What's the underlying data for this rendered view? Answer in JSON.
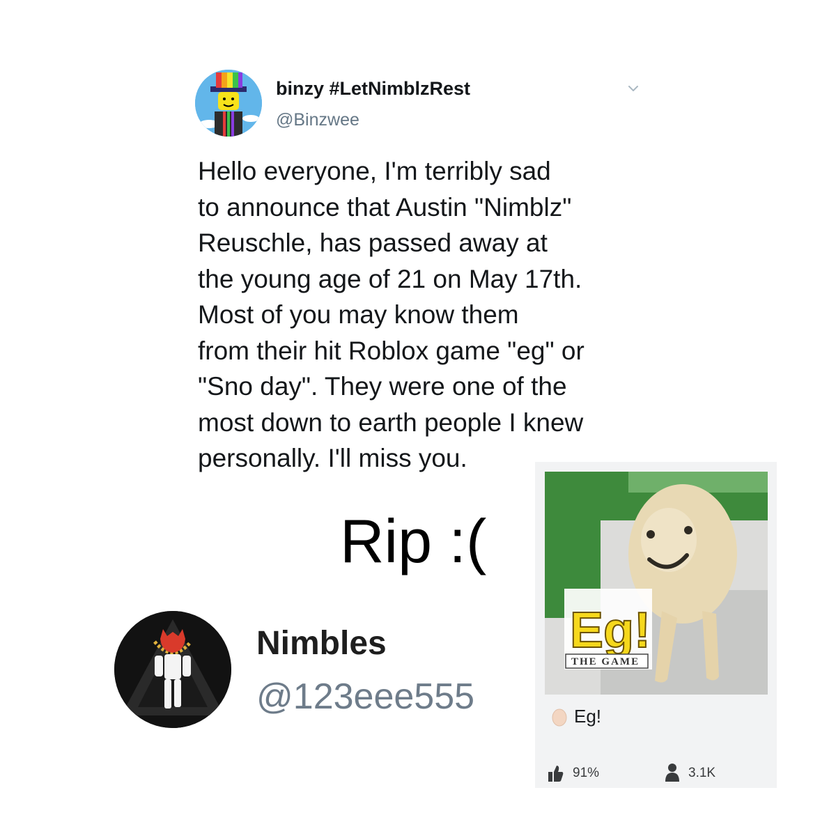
{
  "tweet": {
    "display_name": "binzy #LetNimblzRest",
    "handle": "@Binzwee",
    "body_lines": [
      "Hello everyone, I'm terribly sad",
      "to announce that Austin \"Nimblz\"",
      "Reuschle, has passed away at",
      "the young age of 21 on May 17th.",
      "Most of you may know them",
      "from their hit Roblox game \"eg\" or",
      "\"Sno day\". They were one of the",
      "most down to earth people I knew",
      "personally. I'll miss you."
    ],
    "menu_icon": "chevron-down-icon"
  },
  "caption": "Rip :(",
  "profile": {
    "name": "Nimbles",
    "handle": "@123eee555"
  },
  "game": {
    "title": "Eg!",
    "logo_text": "Eg!",
    "logo_subtext": "THE GAME",
    "rating": "91%",
    "players": "3.1K",
    "rating_icon": "thumbs-up-icon",
    "players_icon": "person-icon"
  },
  "colors": {
    "handle_gray": "#657786",
    "card_background": "#f2f3f4",
    "logo_yellow": "#f6d81c"
  }
}
